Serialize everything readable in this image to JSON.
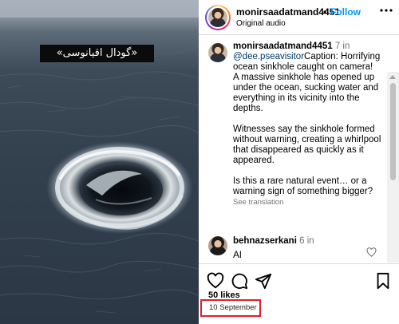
{
  "media": {
    "overlay_text": "«گودال اقیانوسی»",
    "colors": {
      "sea_dark": "#2b3744",
      "sea_mid": "#3d4a57",
      "sky": "#a7b0ba",
      "foam": "#e6ecef",
      "vortex": "#0d1116"
    }
  },
  "header": {
    "username": "monirsaadatmand4451",
    "separator": "•",
    "follow_label": "Follow",
    "subtitle": "Original audio",
    "more_icon": "more-horizontal-icon"
  },
  "caption": {
    "username": "monirsaadatmand4451",
    "time": "7 in",
    "mention": "@dee.pseavisitor",
    "line1": "Caption: Horrifying ocean sinkhole caught on camera!",
    "line2": "A massive sinkhole has opened up under the ocean, sucking water and everything in its vicinity into the depths.",
    "line3": "Witnesses say the sinkhole formed without warning, creating a whirlpool that disappeared as quickly as it appeared.",
    "line4": "Is this a rare natural event… or a warning sign of something bigger?",
    "see_translation": "See translation"
  },
  "comment": {
    "username": "behnazserkani",
    "time": "6 in",
    "text": "Al",
    "like_icon": "heart-outline-icon"
  },
  "actions": {
    "like_icon": "heart-icon",
    "comment_icon": "comment-icon",
    "share_icon": "send-icon",
    "save_icon": "bookmark-icon",
    "likes_text": "50 likes",
    "date": "10 September",
    "highlight_color": "#e0202a",
    "follow_color": "#0095f6"
  }
}
